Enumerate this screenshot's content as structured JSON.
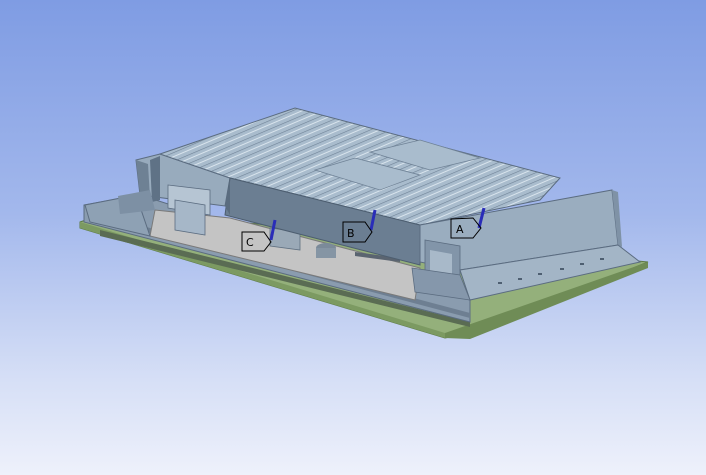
{
  "viewport": {
    "background_top": "#7f9ce3",
    "background_bottom": "#eef1fb"
  },
  "model": {
    "body_color": "#93a6b9",
    "top_face_color": "#a9bccd",
    "pcb_color": "#94b07b",
    "cut_face_color": "#c4c4c4"
  },
  "probes": [
    {
      "label": "A",
      "marker_color": "#2a2db8"
    },
    {
      "label": "B",
      "marker_color": "#2a2db8"
    },
    {
      "label": "C",
      "marker_color": "#2a2db8"
    }
  ]
}
